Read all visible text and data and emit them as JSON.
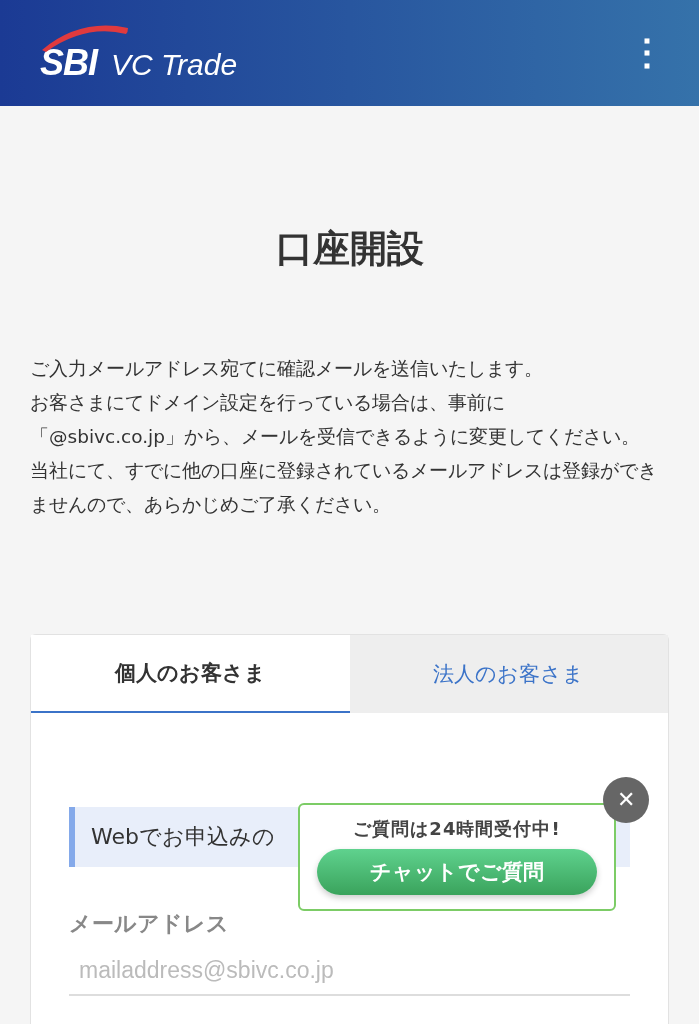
{
  "header": {
    "logo_mark": "SBI",
    "logo_text": "VC Trade",
    "menu": "⋮"
  },
  "title": "口座開設",
  "notice": [
    "ご入力メールアドレス宛てに確認メールを送信いたします。",
    "お客さまにてドメイン設定を行っている場合は、事前に",
    "「@sbivc.co.jp」から、メールを受信できるように変更してください。",
    "当社にて、すでに他の口座に登録されているメールアドレスは登録ができませんので、あらかじめご了承ください。"
  ],
  "tabs": [
    {
      "label": "個人のお客さま",
      "selected": true
    },
    {
      "label": "法人のお客さま",
      "selected": false
    }
  ],
  "info": "Webでお申込みの",
  "email": {
    "label": "メールアドレス",
    "placeholder": "mailaddress@sbivc.co.jp"
  },
  "chat": {
    "headline": "ご質問は24時間受付中!",
    "button": "チャットでご質問",
    "close": "✕"
  }
}
